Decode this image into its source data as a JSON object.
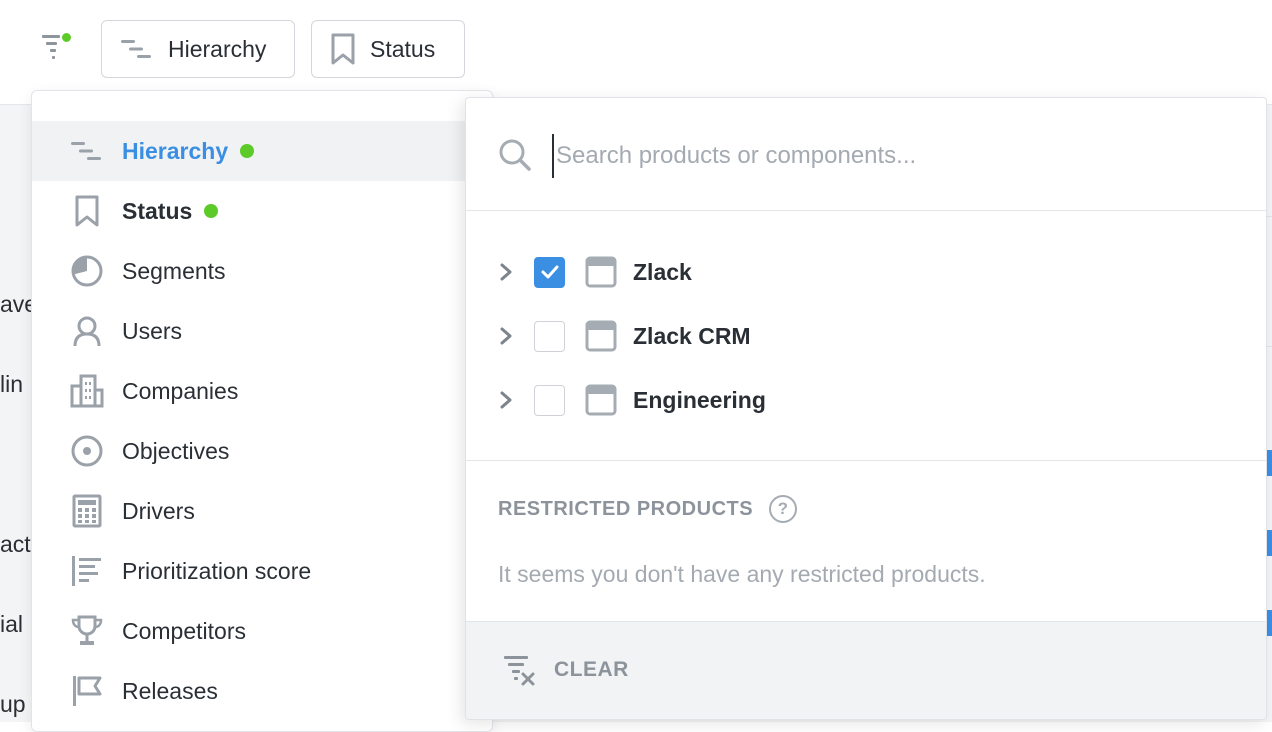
{
  "toolbar": {
    "hierarchy_chip": "Hierarchy",
    "status_chip": "Status"
  },
  "background": {
    "fragments": [
      "ave",
      "lin",
      "acti",
      "ial",
      "up"
    ]
  },
  "menu": {
    "items": [
      {
        "label": "Hierarchy",
        "icon": "hierarchy-icon",
        "active": true,
        "indicator": true
      },
      {
        "label": "Status",
        "icon": "bookmark-icon",
        "bold": true,
        "indicator": true
      },
      {
        "label": "Segments",
        "icon": "pie-icon"
      },
      {
        "label": "Users",
        "icon": "user-icon"
      },
      {
        "label": "Companies",
        "icon": "building-icon"
      },
      {
        "label": "Objectives",
        "icon": "target-icon"
      },
      {
        "label": "Drivers",
        "icon": "calculator-icon"
      },
      {
        "label": "Prioritization score",
        "icon": "score-icon"
      },
      {
        "label": "Competitors",
        "icon": "trophy-icon"
      },
      {
        "label": "Releases",
        "icon": "flag-icon"
      }
    ]
  },
  "panel": {
    "search_placeholder": "Search products or components...",
    "search_value": "",
    "tree": [
      {
        "name": "Zlack",
        "checked": true
      },
      {
        "name": "Zlack CRM",
        "checked": false
      },
      {
        "name": "Engineering",
        "checked": false
      }
    ],
    "restricted_title": "RESTRICTED PRODUCTS",
    "restricted_help": "?",
    "restricted_message": "It seems you don't have any restricted products.",
    "clear_label": "CLEAR"
  },
  "colors": {
    "accent": "#3b8fe3",
    "indicator": "#5ccb2a",
    "muted": "#a4aab1"
  }
}
